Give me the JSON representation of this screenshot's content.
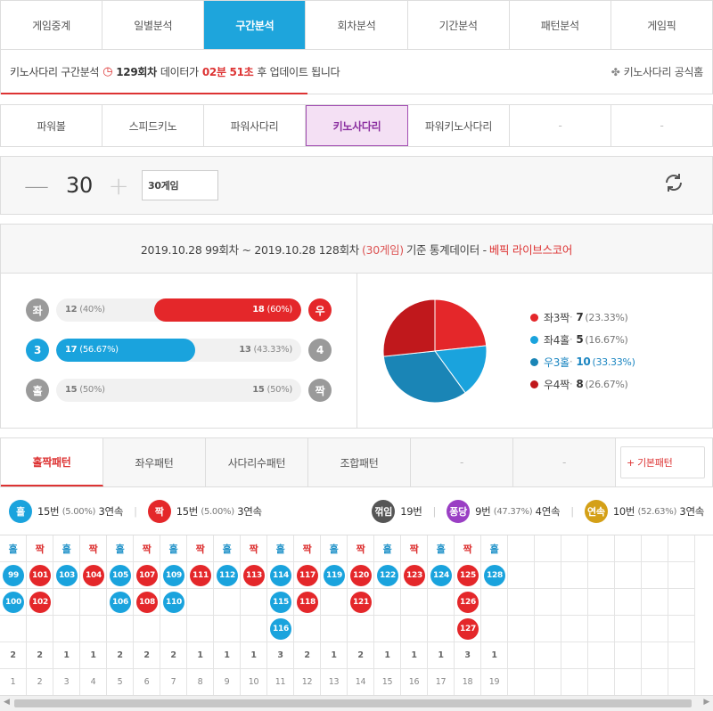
{
  "top_tabs": [
    "게임중계",
    "일별분석",
    "구간분석",
    "회차분석",
    "기간분석",
    "패턴분석",
    "게임픽"
  ],
  "top_active": 2,
  "info": {
    "prefix": "키노사다리 구간분석",
    "round": "129회차",
    "mid": "데이터가",
    "timer": "02분 51초",
    "suffix": "후 업데이트 됩니다",
    "official": "키노사다리 공식홈"
  },
  "game_tabs": [
    "파워볼",
    "스피드키노",
    "파워사다리",
    "키노사다리",
    "파워키노사다리",
    "-",
    "-"
  ],
  "game_active": 3,
  "stepper": {
    "minus": "—",
    "value": "30",
    "plus": "+",
    "select": "30게임"
  },
  "stats_header": {
    "range": "2019.10.28 99회차 ~ 2019.10.28 128회차",
    "games": "(30게임)",
    "suffix": "기준 통계데이터 -",
    "brand": "베픽 라이브스코어"
  },
  "bars": [
    {
      "left_label": "좌",
      "right_label": "우",
      "left_count": "12",
      "left_pct": "(40%)",
      "right_count": "18",
      "right_pct": "(60%)",
      "winner": "right",
      "fill": 0.6,
      "color": "#e4272a",
      "left_circle": "gray",
      "right_circle": "red"
    },
    {
      "left_label": "3",
      "right_label": "4",
      "left_count": "17",
      "left_pct": "(56.67%)",
      "right_count": "13",
      "right_pct": "(43.33%)",
      "winner": "left",
      "fill": 0.5667,
      "color": "#1aa3dd",
      "left_circle": "blue",
      "right_circle": "gray"
    },
    {
      "left_label": "홀",
      "right_label": "짝",
      "left_count": "15",
      "left_pct": "(50%)",
      "right_count": "15",
      "right_pct": "(50%)",
      "winner": "none",
      "fill": 0,
      "color": "#1aa3dd",
      "left_circle": "gray",
      "right_circle": "gray"
    }
  ],
  "pie": {
    "slices": [
      {
        "name": "좌3짝",
        "value": 7,
        "pct": "(23.33%)",
        "color": "#e4272a"
      },
      {
        "name": "좌4홀",
        "value": 5,
        "pct": "(16.67%)",
        "color": "#1aa3dd"
      },
      {
        "name": "우3홀",
        "value": 10,
        "pct": "(33.33%)",
        "color": "#1a85b6",
        "highlight": true
      },
      {
        "name": "우4짝",
        "value": 8,
        "pct": "(26.67%)",
        "color": "#c0181c"
      }
    ]
  },
  "pattern_tabs": [
    "홀짝패턴",
    "좌우패턴",
    "사다리수패턴",
    "조합패턴",
    "-",
    "-"
  ],
  "pattern_active": 0,
  "basic_pattern": "+ 기본패턴",
  "summary": {
    "odd_badge": "홀",
    "odd_text": "15번",
    "odd_pct": "(5.00%)",
    "odd_streak": "3연속",
    "even_badge": "짝",
    "even_text": "15번",
    "even_pct": "(5.00%)",
    "even_streak": "3연속",
    "break_badge": "꺾임",
    "break_text": "19번",
    "pong_badge": "퐁당",
    "pong_text": "9번",
    "pong_pct": "(47.37%)",
    "pong_streak": "4연속",
    "cont_badge": "연속",
    "cont_text": "10번",
    "cont_pct": "(52.63%)",
    "cont_streak": "3연속"
  },
  "pattern_columns": [
    {
      "type": "odd",
      "label": "홀",
      "rounds": [
        "99",
        "100"
      ],
      "count": "2",
      "index": "1"
    },
    {
      "type": "even",
      "label": "짝",
      "rounds": [
        "101",
        "102"
      ],
      "count": "2",
      "index": "2"
    },
    {
      "type": "odd",
      "label": "홀",
      "rounds": [
        "103"
      ],
      "count": "1",
      "index": "3"
    },
    {
      "type": "even",
      "label": "짝",
      "rounds": [
        "104"
      ],
      "count": "1",
      "index": "4"
    },
    {
      "type": "odd",
      "label": "홀",
      "rounds": [
        "105",
        "106"
      ],
      "count": "2",
      "index": "5"
    },
    {
      "type": "even",
      "label": "짝",
      "rounds": [
        "107",
        "108"
      ],
      "count": "2",
      "index": "6"
    },
    {
      "type": "odd",
      "label": "홀",
      "rounds": [
        "109",
        "110"
      ],
      "count": "2",
      "index": "7"
    },
    {
      "type": "even",
      "label": "짝",
      "rounds": [
        "111"
      ],
      "count": "1",
      "index": "8"
    },
    {
      "type": "odd",
      "label": "홀",
      "rounds": [
        "112"
      ],
      "count": "1",
      "index": "9"
    },
    {
      "type": "even",
      "label": "짝",
      "rounds": [
        "113"
      ],
      "count": "1",
      "index": "10"
    },
    {
      "type": "odd",
      "label": "홀",
      "rounds": [
        "114",
        "115",
        "116"
      ],
      "count": "3",
      "index": "11"
    },
    {
      "type": "even",
      "label": "짝",
      "rounds": [
        "117",
        "118"
      ],
      "count": "2",
      "index": "12"
    },
    {
      "type": "odd",
      "label": "홀",
      "rounds": [
        "119"
      ],
      "count": "1",
      "index": "13"
    },
    {
      "type": "even",
      "label": "짝",
      "rounds": [
        "120",
        "121"
      ],
      "count": "2",
      "index": "14"
    },
    {
      "type": "odd",
      "label": "홀",
      "rounds": [
        "122"
      ],
      "count": "1",
      "index": "15"
    },
    {
      "type": "even",
      "label": "짝",
      "rounds": [
        "123"
      ],
      "count": "1",
      "index": "16"
    },
    {
      "type": "odd",
      "label": "홀",
      "rounds": [
        "124"
      ],
      "count": "1",
      "index": "17"
    },
    {
      "type": "even",
      "label": "짝",
      "rounds": [
        "125",
        "126",
        "127"
      ],
      "count": "3",
      "index": "18"
    },
    {
      "type": "odd",
      "label": "홀",
      "rounds": [
        "128"
      ],
      "count": "1",
      "index": "19"
    }
  ],
  "empty_columns": 7
}
